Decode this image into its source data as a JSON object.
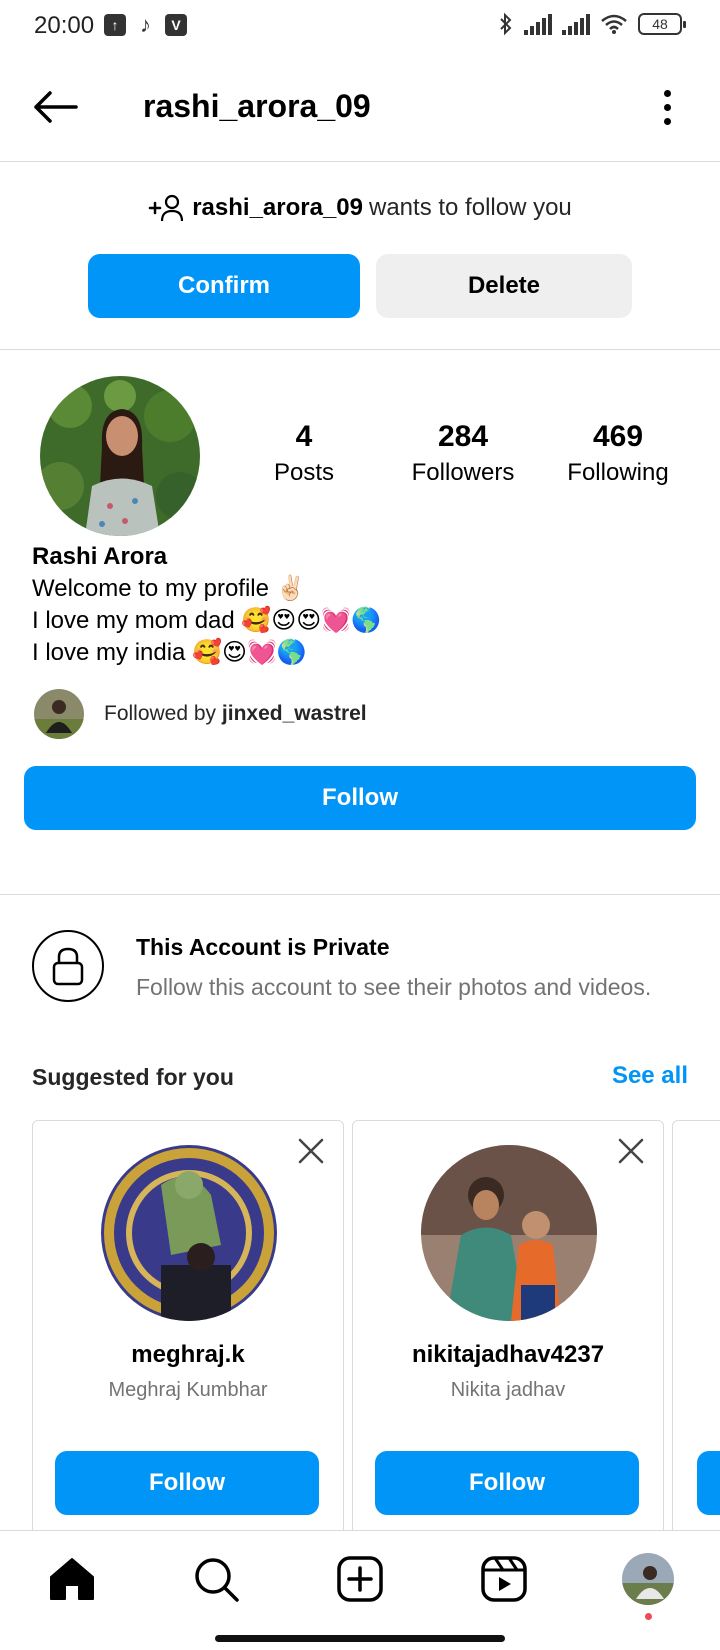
{
  "status_bar": {
    "time": "20:00",
    "battery": "48",
    "left_icons": [
      "upload-icon",
      "tiktok-icon",
      "v-app-icon"
    ],
    "right_icons": [
      "bluetooth-icon",
      "signal-icon",
      "signal-icon",
      "wifi-icon",
      "battery-icon"
    ]
  },
  "header": {
    "title": "rashi_arora_09",
    "back_icon": "arrow-left-icon",
    "more_icon": "more-vertical-icon"
  },
  "request": {
    "username": "rashi_arora_09",
    "text": "wants to follow you",
    "confirm_label": "Confirm",
    "delete_label": "Delete"
  },
  "profile": {
    "stats": [
      {
        "value": "4",
        "label": "Posts"
      },
      {
        "value": "284",
        "label": "Followers"
      },
      {
        "value": "469",
        "label": "Following"
      }
    ],
    "name": "Rashi Arora",
    "bio_lines": [
      "Welcome to my profile ✌🏻",
      "I love my mom dad 🥰😍😍💓🌎",
      "I love my india 🥰😍💓🌎"
    ],
    "followed_by_prefix": "Followed by",
    "followed_by_user": "jinxed_wastrel",
    "follow_label": "Follow"
  },
  "private": {
    "title": "This Account is Private",
    "subtitle": "Follow this account to see their photos and videos."
  },
  "suggested": {
    "title": "Suggested for you",
    "see_all": "See all",
    "cards": [
      {
        "username": "meghraj.k",
        "full_name": "Meghraj Kumbhar",
        "follow_label": "Follow"
      },
      {
        "username": "nikitajadhav4237",
        "full_name": "Nikita jadhav",
        "follow_label": "Follow"
      }
    ]
  },
  "nav": {
    "items": [
      "home-icon",
      "search-icon",
      "create-icon",
      "reels-icon",
      "profile-avatar"
    ]
  },
  "colors": {
    "accent": "#0095f6",
    "secondary_button": "#efefef",
    "muted_text": "#737373",
    "divider": "#dbdbdb",
    "notification_dot": "#ed4956"
  }
}
